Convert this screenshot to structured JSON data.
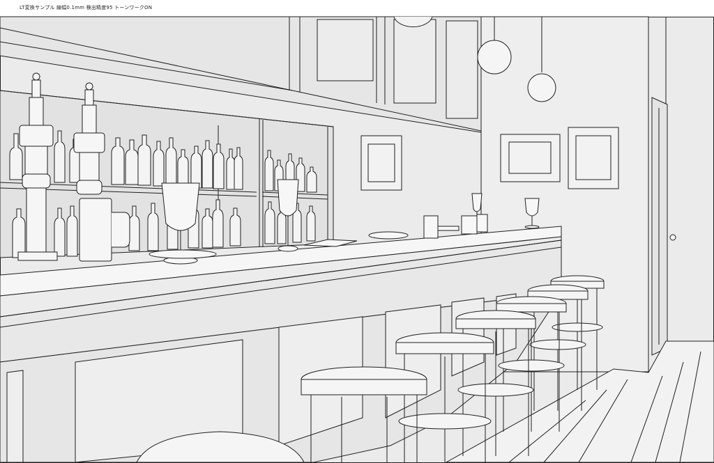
{
  "caption": "LT変換サンプル 線幅0.1mm 検出精度95 トーンワークON",
  "palette": {
    "background": "#ffffff",
    "wall": "#e8e8e8",
    "wall_light": "#f0f0f0",
    "floor": "#f4f4f4",
    "line": "#1f1f1f",
    "line_soft": "#3a3a3a"
  }
}
